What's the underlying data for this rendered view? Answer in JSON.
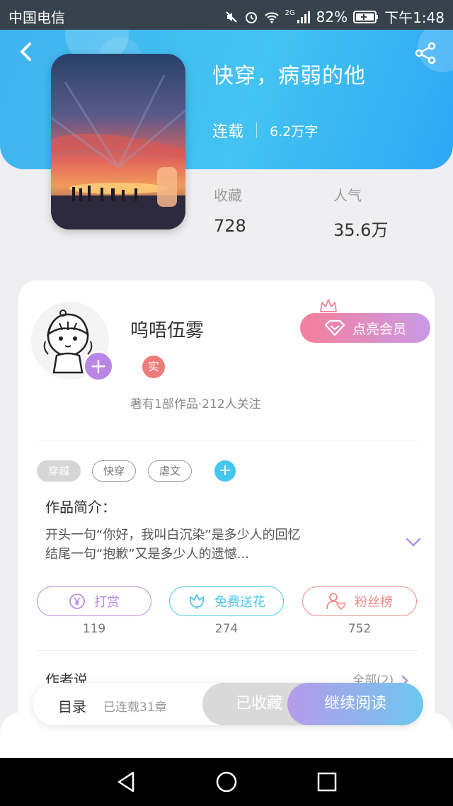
{
  "status_bar": {
    "carrier": "中国电信",
    "network": "2G",
    "battery": "82%",
    "time": "下午1:48"
  },
  "book": {
    "title": "快穿，病弱的他",
    "status": "连载",
    "word_count": "6.2万字"
  },
  "stats": {
    "favorites_label": "收藏",
    "favorites_value": "728",
    "popularity_label": "人气",
    "popularity_value": "35.6万"
  },
  "author": {
    "name": "呜唔伍雾",
    "verified_badge": "实",
    "meta": "著有1部作品·212人关注"
  },
  "vip_button": "点亮会员",
  "tags": [
    "穿越",
    "快穿",
    "虐文"
  ],
  "intro": {
    "title": "作品简介：",
    "line1": "开头一句“你好，我叫白沉染”是多少人的回忆",
    "line2": "结尾一句“抱歉”又是多少人的遗憾..."
  },
  "actions": [
    {
      "label": "打赏",
      "count": "119",
      "color": "#b98fe0"
    },
    {
      "label": "免费送花",
      "count": "274",
      "color": "#4cc7ec"
    },
    {
      "label": "粉丝榜",
      "count": "752",
      "color": "#f08a8a"
    }
  ],
  "author_says": {
    "title": "作者说",
    "all_link": "全部(2)"
  },
  "bottom_bar": {
    "toc": "目录",
    "chapters": "已连载31章",
    "collected": "已收藏",
    "continue": "继续阅读"
  },
  "colors": {
    "header": "#43c3f2",
    "accent_purple": "#b985e6",
    "vip_gradient_start": "#f47f9a"
  }
}
